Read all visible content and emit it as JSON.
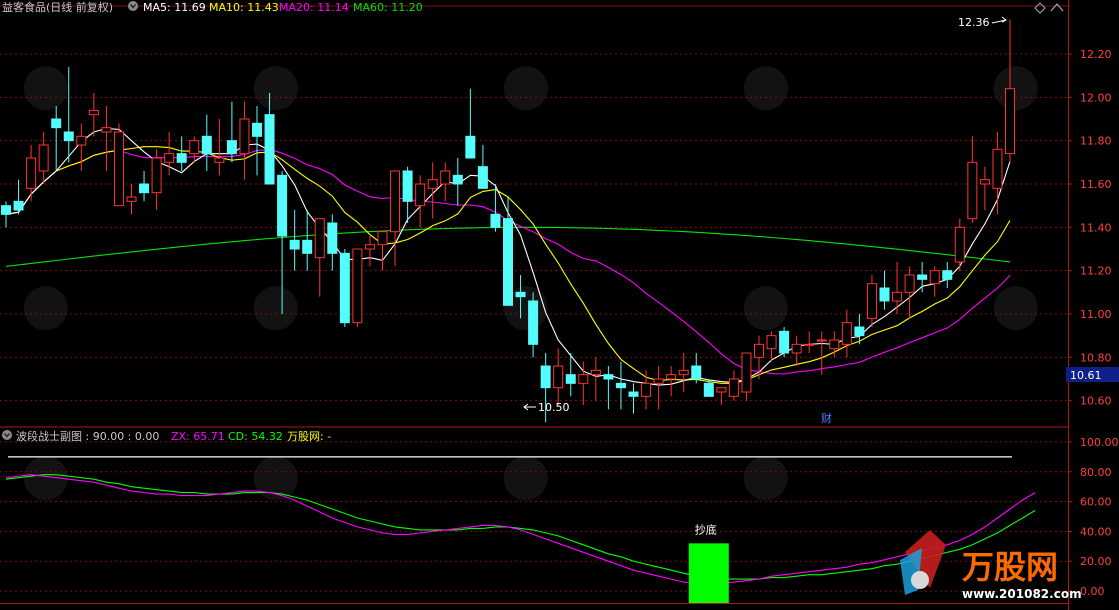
{
  "main_header": {
    "title": "益客食品(日线 前复权)",
    "ma5": "MA5: 11.69",
    "ma10": "MA10: 11.43",
    "ma20": "MA20: 11.14",
    "ma60": "MA60: 11.20"
  },
  "sub_header": {
    "title": "波段战士副图 : 90.00 : 0.00",
    "zx": "ZX: 65.71",
    "cd": "CD: 54.32",
    "site": "万股网: -"
  },
  "annotations": {
    "high": "12.36",
    "low": "10.50",
    "current_price": "10.61",
    "fin_marker": "财",
    "signal": "抄底"
  },
  "watermark": {
    "text": "万股网",
    "url": "www.201082.com"
  },
  "colors": {
    "up": "#ff3232",
    "down": "#54fcfc",
    "ma5": "#ffffff",
    "ma10": "#ffff00",
    "ma20": "#ff00ff",
    "ma60": "#00e600",
    "zx": "#ff00ff",
    "cd": "#00ff00",
    "grid": "#7a1010",
    "signal": "#00ff00"
  },
  "chart_data": [
    {
      "type": "candlestick",
      "title": "益客食品(日线 前复权)",
      "yticks": [
        10.6,
        10.8,
        11.0,
        11.2,
        11.4,
        11.6,
        11.8,
        12.0,
        12.2
      ],
      "ylim": [
        10.52,
        12.32
      ],
      "candles": [
        [
          11.5,
          11.52,
          11.4,
          11.46
        ],
        [
          11.52,
          11.62,
          11.46,
          11.48
        ],
        [
          11.58,
          11.78,
          11.52,
          11.72
        ],
        [
          11.66,
          11.84,
          11.6,
          11.78
        ],
        [
          11.9,
          11.96,
          11.66,
          11.86
        ],
        [
          11.84,
          12.14,
          11.7,
          11.8
        ],
        [
          11.78,
          11.88,
          11.66,
          11.82
        ],
        [
          11.92,
          12.02,
          11.82,
          11.94
        ],
        [
          11.84,
          11.96,
          11.66,
          11.86
        ],
        [
          11.5,
          11.88,
          11.5,
          11.84
        ],
        [
          11.52,
          11.6,
          11.46,
          11.54
        ],
        [
          11.6,
          11.66,
          11.52,
          11.56
        ],
        [
          11.56,
          11.76,
          11.48,
          11.72
        ],
        [
          11.7,
          11.84,
          11.64,
          11.74
        ],
        [
          11.74,
          11.82,
          11.66,
          11.7
        ],
        [
          11.74,
          11.82,
          11.7,
          11.8
        ],
        [
          11.82,
          11.92,
          11.66,
          11.74
        ],
        [
          11.7,
          11.9,
          11.64,
          11.72
        ],
        [
          11.8,
          11.98,
          11.7,
          11.74
        ],
        [
          11.74,
          11.98,
          11.62,
          11.9
        ],
        [
          11.88,
          11.96,
          11.64,
          11.82
        ],
        [
          11.92,
          12.02,
          11.8,
          11.6
        ],
        [
          11.64,
          11.66,
          11.0,
          11.36
        ],
        [
          11.34,
          11.48,
          11.2,
          11.3
        ],
        [
          11.34,
          11.48,
          11.2,
          11.28
        ],
        [
          11.26,
          11.38,
          11.08,
          11.44
        ],
        [
          11.42,
          11.46,
          11.2,
          11.28
        ],
        [
          11.28,
          11.3,
          10.94,
          10.96
        ],
        [
          10.96,
          11.3,
          10.94,
          11.3
        ],
        [
          11.3,
          11.36,
          11.22,
          11.32
        ],
        [
          11.32,
          11.36,
          11.2,
          11.38
        ],
        [
          11.38,
          11.66,
          11.22,
          11.66
        ],
        [
          11.66,
          11.68,
          11.42,
          11.52
        ],
        [
          11.5,
          11.64,
          11.4,
          11.6
        ],
        [
          11.58,
          11.7,
          11.44,
          11.62
        ],
        [
          11.6,
          11.7,
          11.52,
          11.66
        ],
        [
          11.64,
          11.72,
          11.5,
          11.6
        ],
        [
          11.82,
          12.04,
          11.72,
          11.72
        ],
        [
          11.68,
          11.78,
          11.58,
          11.58
        ],
        [
          11.46,
          11.6,
          11.38,
          11.4
        ],
        [
          11.44,
          11.54,
          11.04,
          11.04
        ],
        [
          11.1,
          11.18,
          10.98,
          11.08
        ],
        [
          11.06,
          11.1,
          10.8,
          10.86
        ],
        [
          10.76,
          10.82,
          10.5,
          10.66
        ],
        [
          10.66,
          10.84,
          10.58,
          10.76
        ],
        [
          10.72,
          10.82,
          10.62,
          10.68
        ],
        [
          10.68,
          10.78,
          10.58,
          10.72
        ],
        [
          10.72,
          10.8,
          10.6,
          10.74
        ],
        [
          10.72,
          10.76,
          10.56,
          10.7
        ],
        [
          10.68,
          10.78,
          10.56,
          10.66
        ],
        [
          10.64,
          10.68,
          10.54,
          10.62
        ],
        [
          10.62,
          10.74,
          10.56,
          10.68
        ],
        [
          10.68,
          10.76,
          10.56,
          10.7
        ],
        [
          10.7,
          10.76,
          10.62,
          10.72
        ],
        [
          10.72,
          10.82,
          10.64,
          10.74
        ],
        [
          10.76,
          10.82,
          10.68,
          10.7
        ],
        [
          10.68,
          10.7,
          10.62,
          10.62
        ],
        [
          10.64,
          10.66,
          10.58,
          10.66
        ],
        [
          10.62,
          10.74,
          10.6,
          10.7
        ],
        [
          10.64,
          10.8,
          10.6,
          10.82
        ],
        [
          10.8,
          10.9,
          10.7,
          10.86
        ],
        [
          10.84,
          10.92,
          10.78,
          10.9
        ],
        [
          10.92,
          10.94,
          10.8,
          10.82
        ],
        [
          10.82,
          10.9,
          10.76,
          10.86
        ],
        [
          10.86,
          10.92,
          10.82,
          10.86
        ],
        [
          10.88,
          10.92,
          10.72,
          10.88
        ],
        [
          10.84,
          10.92,
          10.8,
          10.88
        ],
        [
          10.86,
          11.02,
          10.8,
          10.96
        ],
        [
          10.94,
          11.0,
          10.86,
          10.9
        ],
        [
          10.98,
          11.18,
          10.94,
          11.14
        ],
        [
          11.12,
          11.2,
          11.02,
          11.06
        ],
        [
          11.06,
          11.24,
          11.0,
          11.1
        ],
        [
          11.1,
          11.22,
          10.98,
          11.18
        ],
        [
          11.18,
          11.24,
          11.1,
          11.16
        ],
        [
          11.14,
          11.22,
          11.08,
          11.2
        ],
        [
          11.2,
          11.24,
          11.12,
          11.16
        ],
        [
          11.24,
          11.44,
          11.2,
          11.4
        ],
        [
          11.44,
          11.82,
          11.42,
          11.7
        ],
        [
          11.6,
          11.68,
          11.48,
          11.62
        ],
        [
          11.58,
          11.84,
          11.46,
          11.76
        ],
        [
          11.74,
          12.36,
          11.7,
          12.04
        ]
      ]
    },
    {
      "type": "line",
      "title": "波段战士副图",
      "yticks": [
        0,
        20,
        40,
        60,
        80,
        100
      ],
      "ylim": [
        -8,
        108
      ],
      "reference_line": 90,
      "series": [
        {
          "name": "ZX",
          "values": [
            76,
            77,
            78,
            77,
            76,
            75,
            74,
            73,
            71,
            69,
            67,
            66,
            65,
            65,
            64,
            64,
            64,
            65,
            66,
            67,
            67,
            66,
            64,
            61,
            57,
            53,
            49,
            46,
            43,
            41,
            39,
            38,
            38,
            39,
            40,
            41,
            42,
            43,
            44,
            44,
            43,
            41,
            38,
            35,
            32,
            29,
            26,
            23,
            20,
            17,
            14,
            12,
            10,
            8,
            6,
            5,
            5,
            5,
            6,
            7,
            8,
            10,
            11,
            12,
            13,
            14,
            15,
            16,
            18,
            19,
            21,
            23,
            25,
            27,
            29,
            31,
            34,
            38,
            43,
            49,
            55,
            61,
            66
          ]
        },
        {
          "name": "CD",
          "values": [
            75,
            76,
            77,
            78,
            78,
            77,
            76,
            75,
            73,
            72,
            70,
            69,
            68,
            67,
            66,
            66,
            65,
            65,
            65,
            66,
            66,
            66,
            65,
            63,
            61,
            58,
            55,
            52,
            49,
            47,
            45,
            43,
            42,
            41,
            41,
            41,
            41,
            42,
            42,
            43,
            43,
            42,
            41,
            39,
            37,
            34,
            31,
            28,
            25,
            23,
            20,
            18,
            16,
            14,
            12,
            10,
            9,
            8,
            8,
            8,
            8,
            9,
            9,
            10,
            11,
            11,
            12,
            13,
            14,
            15,
            17,
            18,
            20,
            22,
            24,
            26,
            28,
            31,
            35,
            39,
            44,
            49,
            54
          ]
        }
      ],
      "signal": {
        "label": "抄底",
        "index": 56
      }
    }
  ]
}
